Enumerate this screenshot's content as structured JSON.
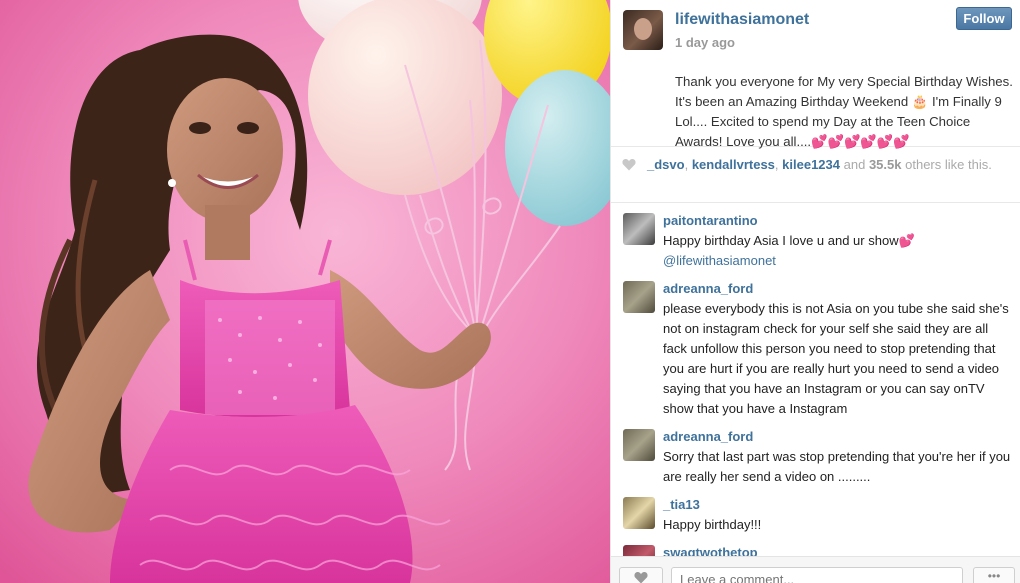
{
  "post": {
    "username": "lifewithasiamonet",
    "time": "1 day ago",
    "follow_label": "Follow",
    "caption": "Thank you everyone for My very Special Birthday Wishes. It's been an Amazing Birthday Weekend 🎂 I'm Finally 9 Lol.... Excited to spend my Day at the Teen Choice Awards! Love you all....💕💕💕💕💕💕"
  },
  "likes": {
    "user1": "_dsvo",
    "user2": "kendallvrtess",
    "user3": "kilee1234",
    "and": "and",
    "count": "35.5k",
    "rest": "others like this."
  },
  "comments": [
    {
      "user": "paitontarantino",
      "text": "Happy birthday Asia I love u and ur show💕",
      "mention": "@lifewithasiamonet"
    },
    {
      "user": "adreanna_ford",
      "text": "please everybody this is not Asia on you tube she said she's not on instagram check for your self she said they are all fack unfollow this person you need to stop pretending that you are hurt if you are really hurt you need to send a video saying that you have an Instagram or you can say onTV show that you have a Instagram"
    },
    {
      "user": "adreanna_ford",
      "text": "Sorry that last part was stop pretending that you're her if you are really her send a video on ........."
    },
    {
      "user": "_tia13",
      "text": "Happy birthday!!!"
    },
    {
      "user": "swagtwothetop",
      "text": ""
    }
  ],
  "footer": {
    "comment_placeholder": "Leave a comment...",
    "more_label": "•••"
  },
  "icons": {
    "heart": "heart-icon",
    "more": "ellipsis-icon"
  },
  "colors": {
    "link": "#3f729b",
    "follow_button": "#4a77a3",
    "photo_background": "#ef7fb6"
  }
}
